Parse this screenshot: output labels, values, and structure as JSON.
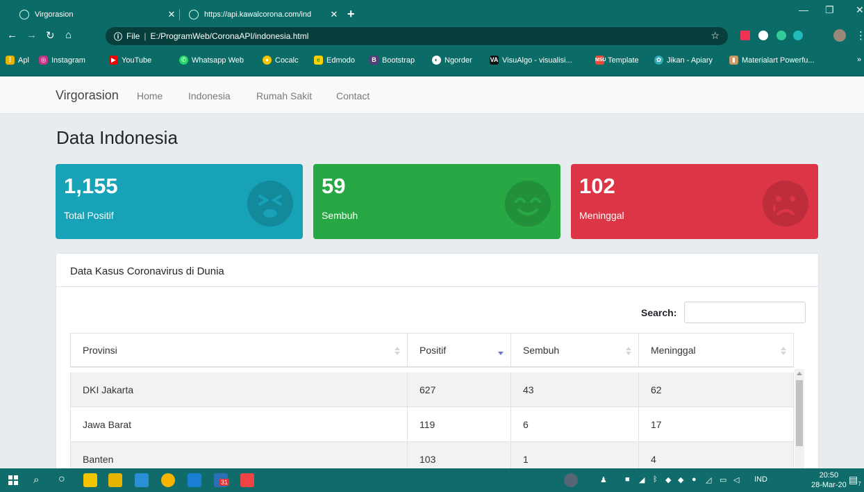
{
  "browser": {
    "tabs": [
      {
        "title": "Virgorasion"
      },
      {
        "title": "https://api.kawalcorona.com/ind"
      }
    ],
    "address": {
      "scheme": "File",
      "path": "E:/ProgramWeb/CoronaAPI/indonesia.html"
    },
    "bookmarks": [
      {
        "label": "Apl",
        "icon": "apps-grid-icon"
      },
      {
        "label": "Instagram",
        "icon": "instagram-icon"
      },
      {
        "label": "YouTube",
        "icon": "youtube-icon"
      },
      {
        "label": "Whatsapp Web",
        "icon": "whatsapp-icon"
      },
      {
        "label": "Cocalc",
        "icon": "cocalc-icon"
      },
      {
        "label": "Edmodo",
        "icon": "edmodo-icon"
      },
      {
        "label": "Bootstrap",
        "icon": "bootstrap-icon"
      },
      {
        "label": "Ngorder",
        "icon": "globe-icon"
      },
      {
        "label": "VisuAlgo - visualisi...",
        "icon": "visualgo-icon"
      },
      {
        "label": "Template",
        "icon": "template-icon"
      },
      {
        "label": "Jikan - Apiary",
        "icon": "apiary-icon"
      },
      {
        "label": "Materialart Powerfu...",
        "icon": "materialart-icon"
      }
    ]
  },
  "nav": {
    "brand": "Virgorasion",
    "links": [
      "Home",
      "Indonesia",
      "Rumah Sakit",
      "Contact"
    ]
  },
  "page": {
    "title": "Data Indonesia"
  },
  "stats": [
    {
      "value": "1,155",
      "label": "Total Positif",
      "color": "#17a2b8",
      "icon": "dizzy-face-icon"
    },
    {
      "value": "59",
      "label": "Sembuh",
      "color": "#28a745",
      "icon": "smile-face-icon"
    },
    {
      "value": "102",
      "label": "Meninggal",
      "color": "#dc3545",
      "icon": "sad-tear-face-icon"
    }
  ],
  "table": {
    "card_title": "Data Kasus Coronavirus di Dunia",
    "search_label": "Search:",
    "columns": [
      "Provinsi",
      "Positif",
      "Sembuh",
      "Meninggal"
    ],
    "rows": [
      [
        "DKI Jakarta",
        "627",
        "43",
        "62"
      ],
      [
        "Jawa Barat",
        "119",
        "6",
        "17"
      ],
      [
        "Banten",
        "103",
        "1",
        "4"
      ]
    ]
  },
  "taskbar": {
    "calendar_badge": "31",
    "language": "IND",
    "time": "20:50",
    "date": "28-Mar-20",
    "notification_count": "7"
  }
}
